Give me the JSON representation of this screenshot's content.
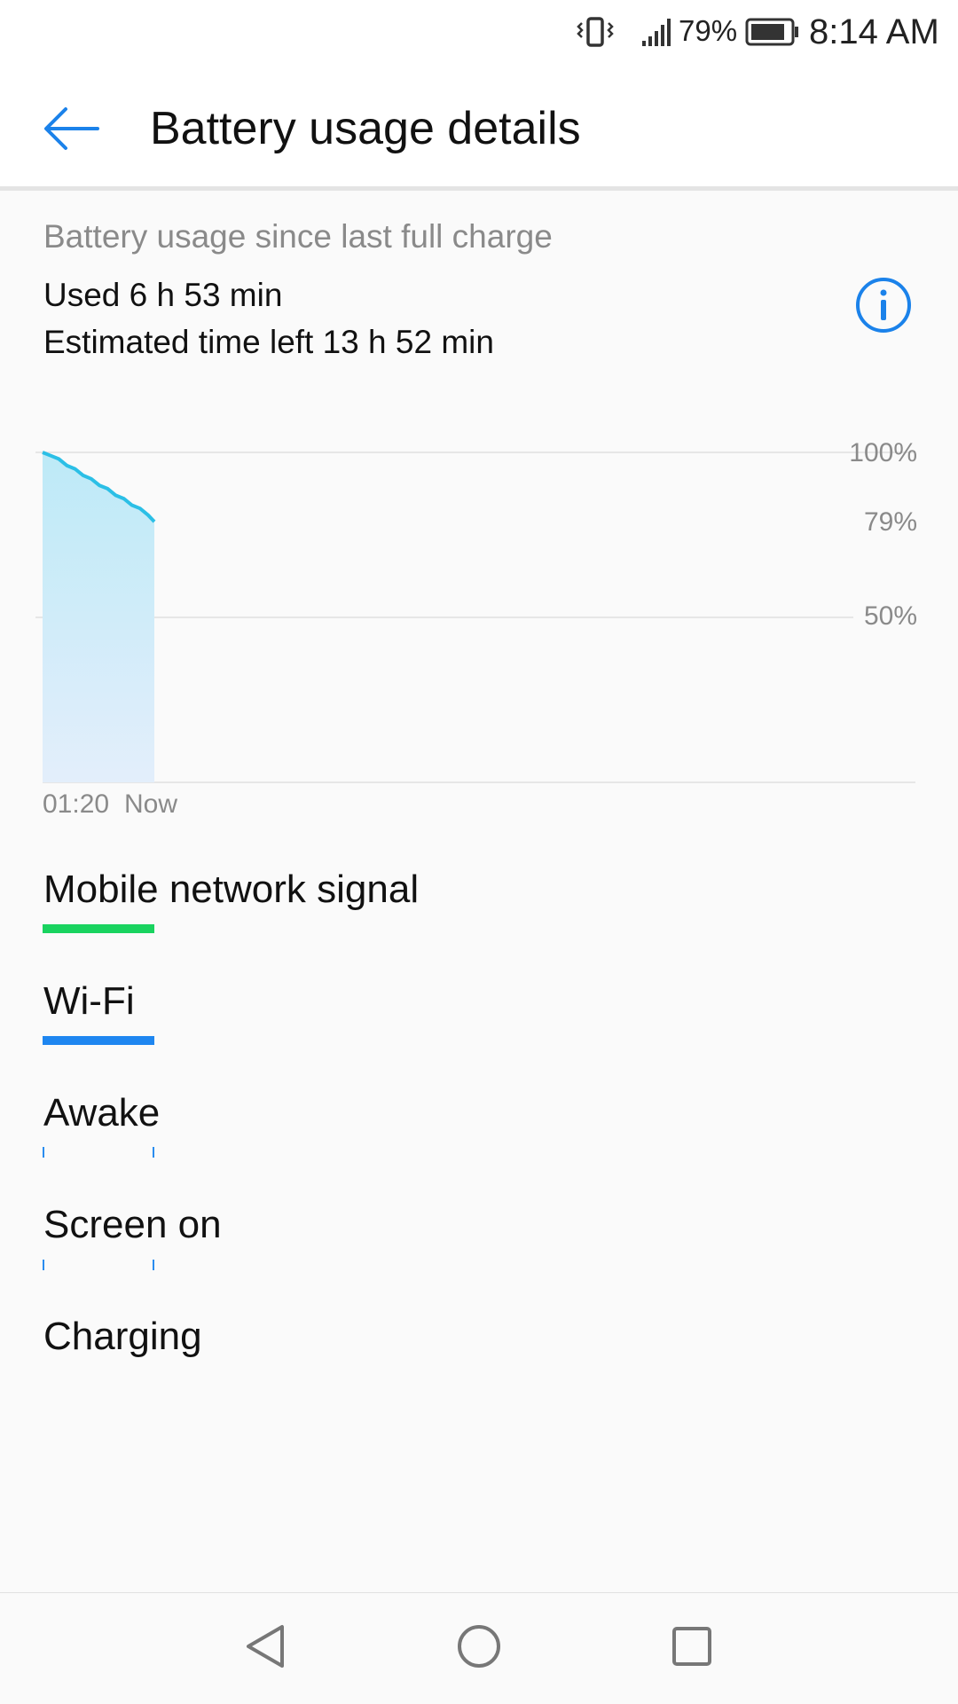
{
  "status_bar": {
    "battery_percent": "79%",
    "time": "8:14 AM",
    "icons": [
      "vibrate-icon",
      "signal-icon",
      "battery-icon"
    ]
  },
  "app_bar": {
    "title": "Battery usage details",
    "back_icon": "arrow-left-icon"
  },
  "summary": {
    "since_label": "Battery usage since last full charge",
    "used": "Used 6 h 53 min",
    "estimated": "Estimated time left 13 h 52 min",
    "info_icon": "info-icon"
  },
  "chart_data": {
    "type": "area",
    "y_tick_labels": [
      "100%",
      "79%",
      "50%"
    ],
    "x_tick_labels": [
      "01:20",
      "Now"
    ],
    "ylim": [
      0,
      100
    ],
    "x_hours": [
      0,
      0.5,
      1.0,
      1.5,
      2.0,
      2.5,
      3.0,
      3.5,
      4.0,
      4.5,
      5.0,
      5.5,
      6.0,
      6.5,
      6.88
    ],
    "values": [
      100,
      99,
      98,
      96,
      95,
      93,
      92,
      90,
      89,
      87,
      86,
      84,
      83,
      81,
      79
    ],
    "grid": true,
    "colors": {
      "line": "#2bbfe6",
      "fill_top": "#bdeaf7",
      "fill_bottom": "#e3eefb"
    }
  },
  "legend": {
    "mobile_network_signal": "Mobile network signal",
    "wifi": "Wi-Fi",
    "awake": "Awake",
    "screen_on": "Screen on",
    "charging": "Charging",
    "colors": {
      "mobile": "#19d35f",
      "wifi": "#1e86f0",
      "tick": "#2a8cef"
    }
  },
  "nav": {
    "back_icon": "triangle-back-icon",
    "home_icon": "circle-home-icon",
    "recents_icon": "square-recents-icon"
  }
}
